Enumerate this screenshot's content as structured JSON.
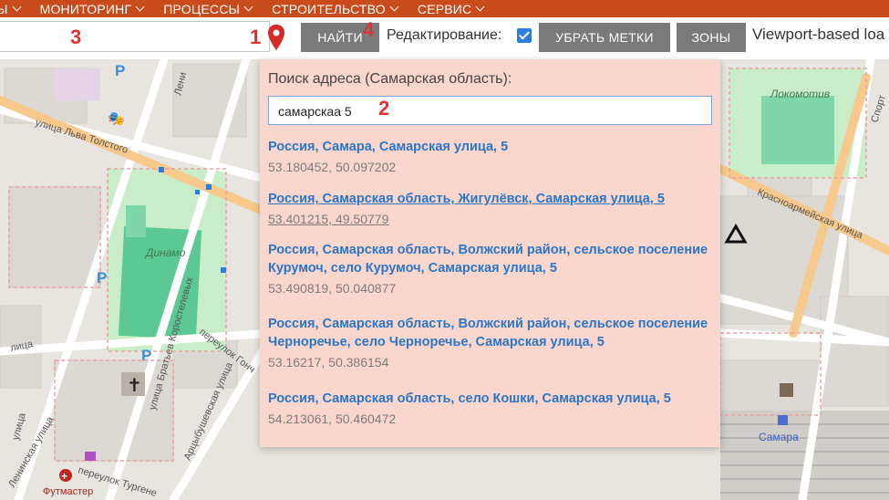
{
  "nav": {
    "items": [
      {
        "label": "Ы"
      },
      {
        "label": "МОНИТОРИНГ"
      },
      {
        "label": "ПРОЦЕССЫ"
      },
      {
        "label": "СТРОИТЕЛЬСТВО"
      },
      {
        "label": "СЕРВИС"
      }
    ]
  },
  "toolbar": {
    "search_value": "",
    "find_label": "НАЙТИ",
    "edit_label": "Редактирование:",
    "edit_checked": true,
    "clear_label": "УБРАТЬ МЕТКИ",
    "zones_label": "ЗОНЫ",
    "viewport_label": "Viewport-based loa"
  },
  "annotations": [
    "1",
    "2",
    "3",
    "4"
  ],
  "map": {
    "labels": {
      "lenina": "Лени",
      "lokomotiv": "Локомотив",
      "sport": "Спорт",
      "tolstogo": "улица Льва Толстого",
      "dinamo": "Динамо",
      "krasnoarmeyskaya": "Красноармейская улица",
      "gonch": "переулок Гонч",
      "bratiev": "улица Братьев Коростелевых",
      "artsybush": "Арцыбушевская улица",
      "leninsk": "Ленинская улица",
      "turgen": "переулок Тургене",
      "samara": "Самара",
      "futmaster": "Футмастер",
      "lenina2": "лица",
      "lenina3": "улица"
    },
    "parking_symbol": "P"
  },
  "popup": {
    "title": "Поиск адреса (Самарская область):",
    "query": "самарскаа 5",
    "results": [
      {
        "address": "Россия, Самара, Самарская улица, 5",
        "coords": "53.180452, 50.097202"
      },
      {
        "address": "Россия, Самарская область, Жигулёвск, Самарская улица, 5",
        "coords": "53.401215, 49.50779"
      },
      {
        "address": "Россия, Самарская область, Волжский район, сельское поселение Курумоч, село Курумоч, Самарская улица, 5",
        "coords": "53.490819, 50.040877"
      },
      {
        "address": "Россия, Самарская область, Волжский район, сельское поселение Черноречье, село Черноречье, Самарская улица, 5",
        "coords": "53.16217, 50.386154"
      },
      {
        "address": "Россия, Самарская область, село Кошки, Самарская улица, 5",
        "coords": "54.213061, 50.460472"
      }
    ]
  }
}
